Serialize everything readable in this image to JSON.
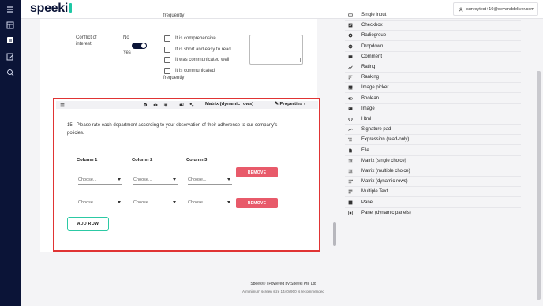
{
  "header": {
    "logo": "speeki",
    "user_email": "surveytest+10@devanddeliver.com"
  },
  "canvas": {
    "frequently_top": "frequently",
    "conflict_label": "Conflict of interest",
    "toggle_no": "No",
    "toggle_yes": "Yes",
    "options": [
      "It is comprehensive",
      "It is short and easy to read",
      "It was communicated well",
      "It is communicated"
    ],
    "frequently_bottom": "frequently"
  },
  "question": {
    "type_title": "Matrix (dynamic rows)",
    "properties_label": "Properties",
    "number": "15.",
    "text": "Please rate each department according to your observation of their adherence to our company's policies.",
    "columns": [
      "Column 1",
      "Column 2",
      "Column 3"
    ],
    "rows": [
      {
        "cells": [
          "Choose...",
          "Choose...",
          "Choose..."
        ],
        "remove": "REMOVE"
      },
      {
        "cells": [
          "Choose...",
          "Choose...",
          "Choose..."
        ],
        "remove": "REMOVE"
      }
    ],
    "add_row": "ADD ROW"
  },
  "toolbox": {
    "items": [
      {
        "label": "Single input",
        "icon": "single-input-icon"
      },
      {
        "label": "Checkbox",
        "icon": "checkbox-icon"
      },
      {
        "label": "Radiogroup",
        "icon": "radiogroup-icon"
      },
      {
        "label": "Dropdown",
        "icon": "dropdown-icon"
      },
      {
        "label": "Comment",
        "icon": "comment-icon"
      },
      {
        "label": "Rating",
        "icon": "rating-icon"
      },
      {
        "label": "Ranking",
        "icon": "ranking-icon"
      },
      {
        "label": "Image picker",
        "icon": "image-picker-icon"
      },
      {
        "label": "Boolean",
        "icon": "boolean-icon"
      },
      {
        "label": "Image",
        "icon": "image-icon"
      },
      {
        "label": "Html",
        "icon": "html-icon"
      },
      {
        "label": "Signature pad",
        "icon": "signature-pad-icon"
      },
      {
        "label": "Expression (read-only)",
        "icon": "expression-icon"
      },
      {
        "label": "File",
        "icon": "file-icon"
      },
      {
        "label": "Matrix (single choice)",
        "icon": "matrix-single-icon"
      },
      {
        "label": "Matrix (multiple choice)",
        "icon": "matrix-multiple-icon"
      },
      {
        "label": "Matrix (dynamic rows)",
        "icon": "matrix-dynamic-icon"
      },
      {
        "label": "Multiple Text",
        "icon": "multiple-text-icon"
      },
      {
        "label": "Panel",
        "icon": "panel-icon"
      },
      {
        "label": "Panel (dynamic panels)",
        "icon": "panel-dynamic-icon"
      }
    ]
  },
  "footer": {
    "powered": "Speeki® | Powered by Speeki Pte Ltd",
    "note": "A minimum screen size 1440x900 is recommended"
  },
  "colors": {
    "navy": "#0b1437",
    "accent_teal": "#1ec8a5",
    "selection_red": "#e03434",
    "remove_button": "#e85a6a"
  }
}
